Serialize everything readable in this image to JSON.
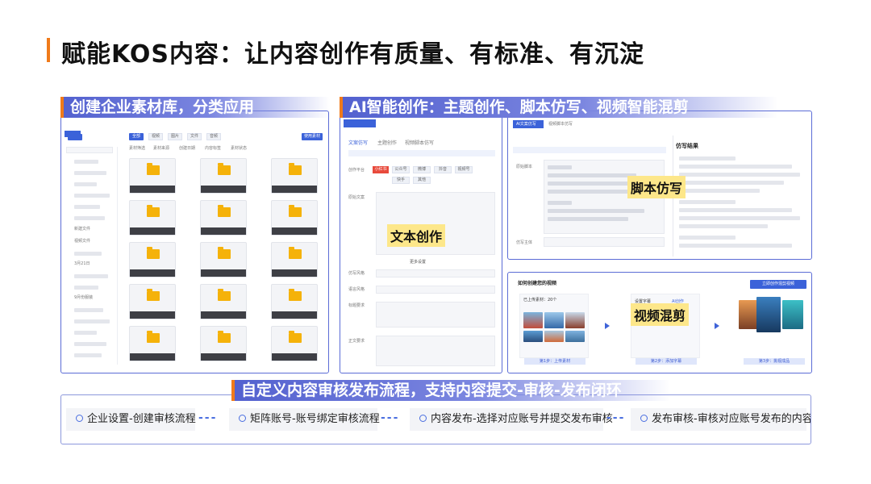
{
  "page": {
    "title": "赋能KOS内容：让内容创作有质量、有标准、有沉淀"
  },
  "panels": {
    "library": {
      "banner": "创建企业素材库，分类应用"
    },
    "ai": {
      "banner": "AI智能创作：主题创作、脚本仿写、视频智能混剪"
    },
    "flow": {
      "banner": "自定义内容审核发布流程，支持内容提交-审核-发布闭环"
    }
  },
  "labels": {
    "text_creation": "文本创作",
    "script_imitation": "脚本仿写",
    "video_mix": "视频混剪"
  },
  "library_ui": {
    "toolbar": [
      "全部",
      "视频",
      "图片",
      "文件",
      "音频"
    ],
    "filters": [
      "素材筛选",
      "素材来源",
      "创建日期",
      "内容标签",
      "素材状态"
    ],
    "tree_items": [
      "新建文件",
      "视频文件",
      "3月21日",
      "9月份服装"
    ],
    "upload_label": "使用素材",
    "card_caption": "子文件夹"
  },
  "text_ui": {
    "tabs": [
      "文案仿写",
      "主题创作",
      "视频脚本仿写"
    ],
    "platform_label": "创作平台",
    "platforms": [
      "小红书",
      "公众号",
      "微博",
      "抖音",
      "视频号",
      "快手",
      "其他"
    ],
    "fields": [
      "原始文案",
      "仿写风格",
      "语言风格",
      "标题要求",
      "正文要求"
    ],
    "more": "更多设置"
  },
  "script_ui": {
    "tabs": [
      "AI文案仿写",
      "视频脚本仿写"
    ],
    "result_title": "仿写结果",
    "source_label": "原始脚本",
    "subject_label": "仿写主体"
  },
  "video_ui": {
    "title": "如何创建您的视频",
    "upload_title": "已上传素材：20个",
    "step_tags": [
      "第1步：上传素材",
      "第2步：添加字幕",
      "第3步：挑视成品"
    ],
    "create_button": "立即创作混剪视频",
    "subtitle_label": "设置字幕",
    "ai_label": "AI创作"
  },
  "flow_steps": [
    "企业设置-创建审核流程",
    "矩阵账号-账号绑定审核流程",
    "内容发布-选择对应账号并提交发布审核",
    "发布审核-审核对应账号发布的内容"
  ],
  "flow_dash": "---",
  "colors": {
    "accent": "#f07a1a",
    "brand_blue": "#5361cf",
    "label_yellow": "#fde78a",
    "folder": "#f5b20a"
  }
}
